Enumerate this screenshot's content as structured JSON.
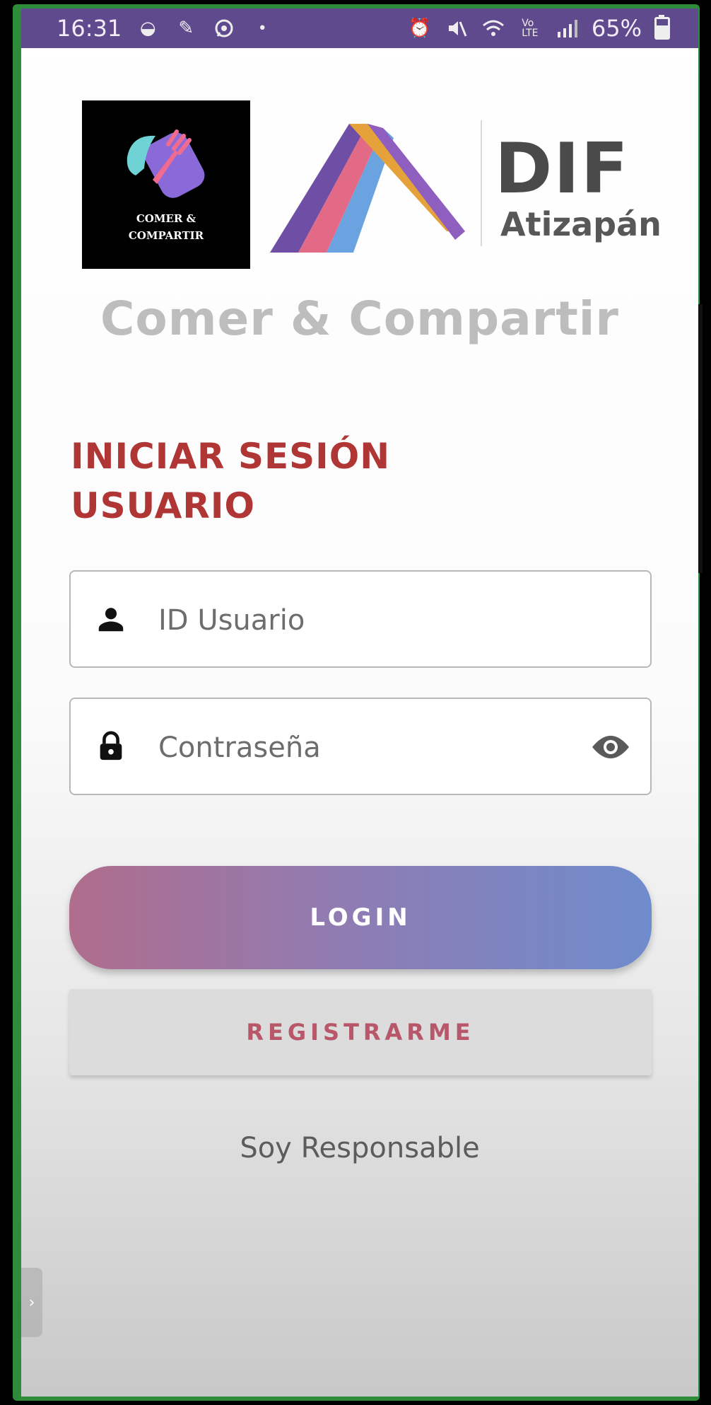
{
  "status_bar": {
    "time": "16:31",
    "battery": "65%",
    "left_icons": [
      "notification-icon",
      "signal-app-icon",
      "whatsapp-icon",
      "dot-icon"
    ],
    "right_icons": [
      "alarm-icon",
      "mute-icon",
      "wifi-icon",
      "volte-icon",
      "signal-icon",
      "battery-icon"
    ]
  },
  "logos": {
    "comer_line1": "COMER &",
    "comer_line2": "COMPARTIR",
    "dif": "DIF",
    "atizapan": "Atizapán"
  },
  "app_title": "Comer & Compartir",
  "heading": {
    "line1": "INICIAR SESIÓN",
    "line2": "USUARIO"
  },
  "form": {
    "user_placeholder": "ID Usuario",
    "password_placeholder": "Contraseña"
  },
  "buttons": {
    "login": "LOGIN",
    "register": "REGISTRARME"
  },
  "links": {
    "responsable": "Soy Responsable"
  },
  "colors": {
    "heading": "#b03535",
    "status_bar": "#5f4a8e",
    "login_gradient_start": "#b06d8d",
    "login_gradient_end": "#6f8ccc",
    "register_text": "#b8566a",
    "frame": "#2e8b3a"
  }
}
